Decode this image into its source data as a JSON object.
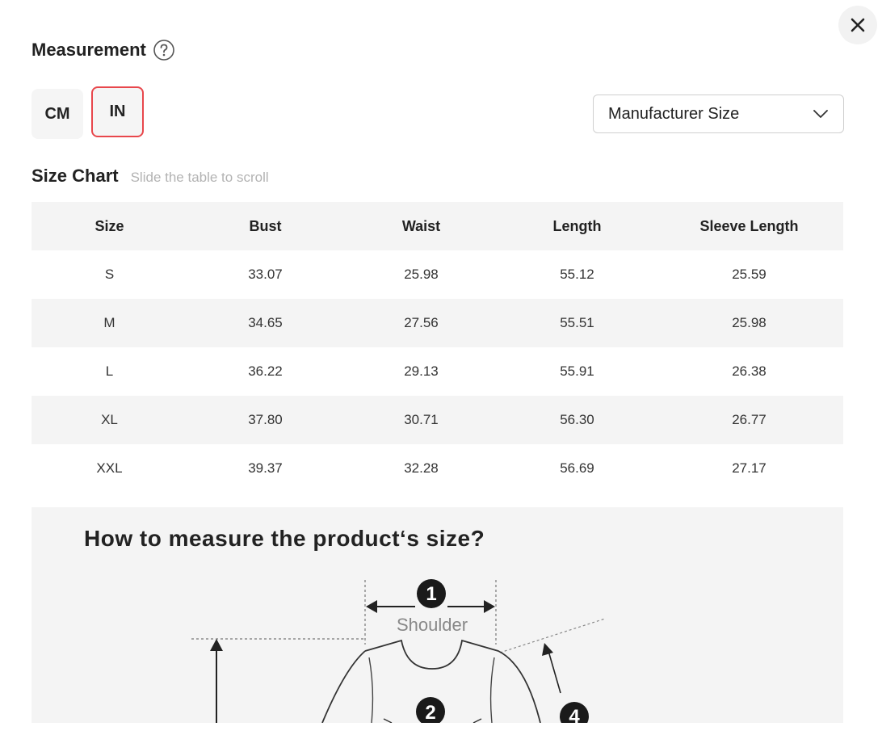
{
  "header": {
    "title": "Measurement",
    "help_icon": "question-circle-icon",
    "close_icon": "close-icon"
  },
  "units": {
    "cm_label": "CM",
    "in_label": "IN",
    "selected": "IN",
    "accent": "#e8474c"
  },
  "size_select": {
    "value": "Manufacturer Size",
    "icon": "chevron-down-icon"
  },
  "size_chart": {
    "title": "Size Chart",
    "hint": "Slide the table to scroll",
    "columns": [
      "Size",
      "Bust",
      "Waist",
      "Length",
      "Sleeve Length"
    ],
    "rows": [
      [
        "S",
        "33.07",
        "25.98",
        "55.12",
        "25.59"
      ],
      [
        "M",
        "34.65",
        "27.56",
        "55.51",
        "25.98"
      ],
      [
        "L",
        "36.22",
        "29.13",
        "55.91",
        "26.38"
      ],
      [
        "XL",
        "37.80",
        "30.71",
        "56.30",
        "26.77"
      ],
      [
        "XXL",
        "39.37",
        "32.28",
        "56.69",
        "27.17"
      ]
    ]
  },
  "guide": {
    "title": "How to measure the product‘s size?",
    "shoulder_label": "Shoulder",
    "markers": [
      "1",
      "2",
      "4"
    ]
  }
}
